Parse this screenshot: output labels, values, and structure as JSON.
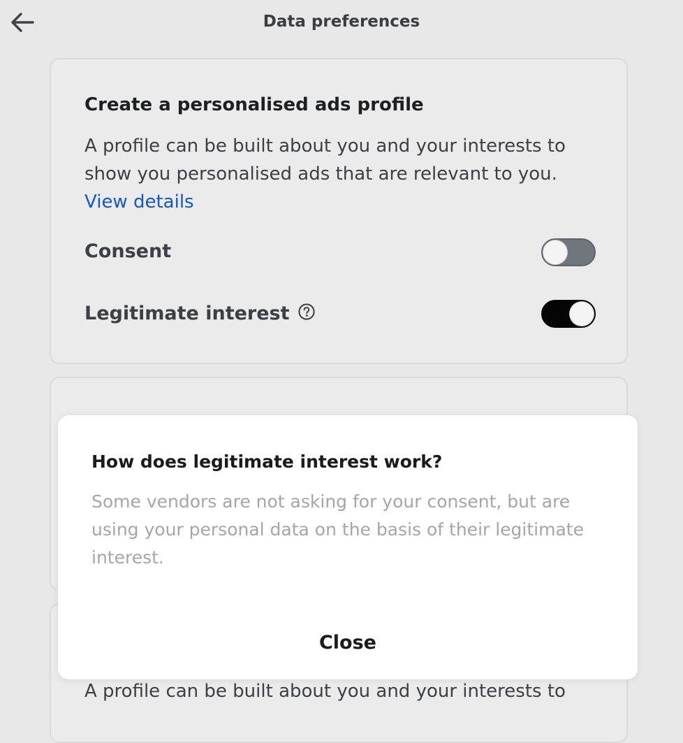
{
  "header": {
    "title": "Data preferences",
    "back_icon": "arrow-left-icon"
  },
  "purpose_card": {
    "title": "Create a personalised ads profile",
    "description": "A profile can be built about you and your interests to show you personalised ads that are relevant to you.",
    "view_details": "View details",
    "consent": {
      "label": "Consent",
      "state": "off"
    },
    "legitimate_interest": {
      "label": "Legitimate interest",
      "help_icon": "question-circle-icon",
      "state": "on"
    }
  },
  "next_card": {
    "description_partial": "A profile can be built about you and your interests to"
  },
  "modal": {
    "title": "How does legitimate interest work?",
    "body": "Some vendors are not asking for your consent, but are using your personal data on the basis of their legitimate interest.",
    "close_label": "Close"
  },
  "colors": {
    "background": "#e8e8e8",
    "link": "#1458c8",
    "toggle_on": "#050505",
    "toggle_off": "#6f767d"
  }
}
